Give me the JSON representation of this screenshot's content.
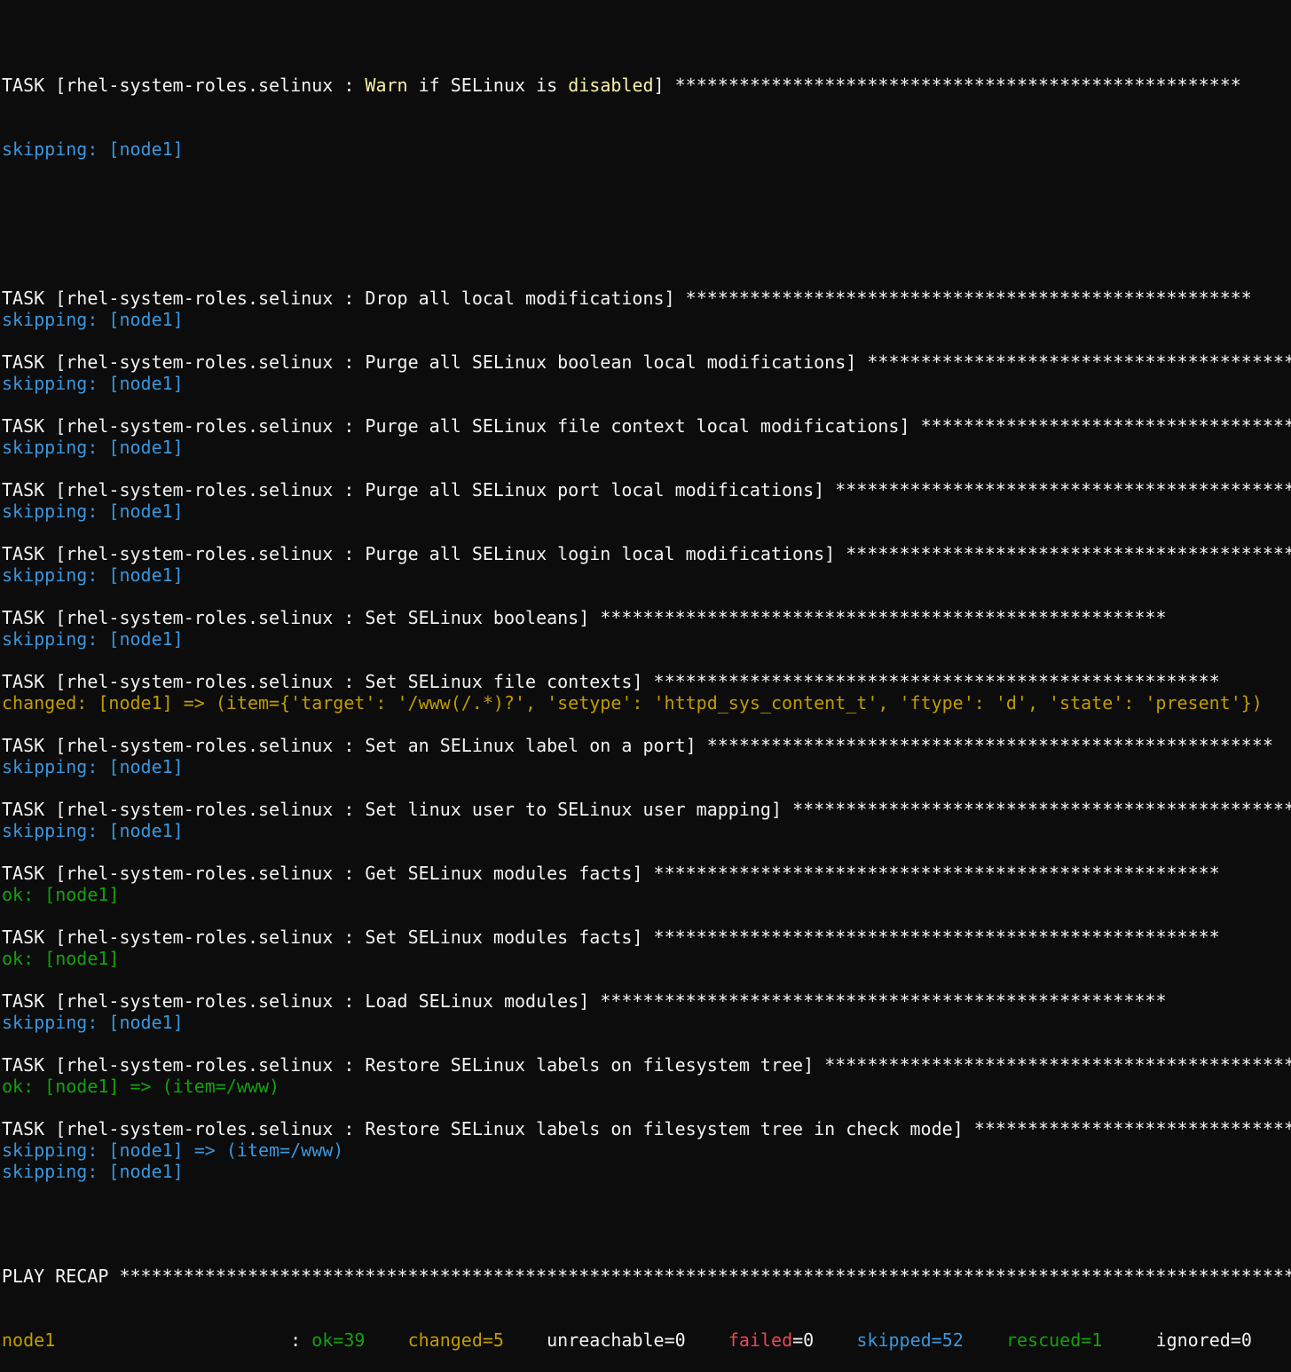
{
  "tasks": [
    {
      "title": "TASK [rhel-system-roles.selinux : ",
      "name_plain": "",
      "name_warn": "Warn",
      "name_mid": " if SELinux is ",
      "name_warn2": "disabled",
      "close": "] ",
      "stars": "*****************************************************",
      "results": [
        {
          "kind": "skip",
          "text": "skipping: [node1]"
        }
      ]
    },
    {
      "title": "TASK [rhel-system-roles.selinux : ",
      "name": "Drop all local modifications",
      "close": "] ",
      "stars": "*****************************************************",
      "results": [
        {
          "kind": "skip",
          "text": "skipping: [node1]"
        }
      ]
    },
    {
      "title": "TASK [rhel-system-roles.selinux : ",
      "name": "Purge all SELinux boolean local modifications",
      "close": "] ",
      "stars": "*****************************************************",
      "results": [
        {
          "kind": "skip",
          "text": "skipping: [node1]"
        }
      ]
    },
    {
      "title": "TASK [rhel-system-roles.selinux : ",
      "name": "Purge all SELinux file context local modifications",
      "close": "] ",
      "stars": "*****************************************************",
      "results": [
        {
          "kind": "skip",
          "text": "skipping: [node1]"
        }
      ]
    },
    {
      "title": "TASK [rhel-system-roles.selinux : ",
      "name": "Purge all SELinux port local modifications",
      "close": "] ",
      "stars": "*****************************************************",
      "results": [
        {
          "kind": "skip",
          "text": "skipping: [node1]"
        }
      ]
    },
    {
      "title": "TASK [rhel-system-roles.selinux : ",
      "name": "Purge all SELinux login local modifications",
      "close": "] ",
      "stars": "*****************************************************",
      "results": [
        {
          "kind": "skip",
          "text": "skipping: [node1]"
        }
      ]
    },
    {
      "title": "TASK [rhel-system-roles.selinux : ",
      "name": "Set SELinux booleans",
      "close": "] ",
      "stars": "*****************************************************",
      "results": [
        {
          "kind": "skip",
          "text": "skipping: [node1]"
        }
      ]
    },
    {
      "title": "TASK [rhel-system-roles.selinux : ",
      "name": "Set SELinux file contexts",
      "close": "] ",
      "stars": "*****************************************************",
      "results": [
        {
          "kind": "changed",
          "text": "changed: [node1] => (item={'target': '/www(/.*)?', 'setype': 'httpd_sys_content_t', 'ftype': 'd', 'state': 'present'})"
        }
      ]
    },
    {
      "title": "TASK [rhel-system-roles.selinux : ",
      "name": "Set an SELinux label on a port",
      "close": "] ",
      "stars": "*****************************************************",
      "results": [
        {
          "kind": "skip",
          "text": "skipping: [node1]"
        }
      ]
    },
    {
      "title": "TASK [rhel-system-roles.selinux : ",
      "name": "Set linux user to SELinux user mapping",
      "close": "] ",
      "stars": "*****************************************************",
      "results": [
        {
          "kind": "skip",
          "text": "skipping: [node1]"
        }
      ]
    },
    {
      "title": "TASK [rhel-system-roles.selinux : ",
      "name": "Get SELinux modules facts",
      "close": "] ",
      "stars": "*****************************************************",
      "results": [
        {
          "kind": "ok",
          "text": "ok: [node1]"
        }
      ]
    },
    {
      "title": "TASK [rhel-system-roles.selinux : ",
      "name": "Set SELinux modules facts",
      "close": "] ",
      "stars": "*****************************************************",
      "results": [
        {
          "kind": "ok",
          "text": "ok: [node1]"
        }
      ]
    },
    {
      "title": "TASK [rhel-system-roles.selinux : ",
      "name": "Load SELinux modules",
      "close": "] ",
      "stars": "*****************************************************",
      "results": [
        {
          "kind": "skip",
          "text": "skipping: [node1]"
        }
      ]
    },
    {
      "title": "TASK [rhel-system-roles.selinux : ",
      "name": "Restore SELinux labels on filesystem tree",
      "close": "] ",
      "stars": "*****************************************************",
      "results": [
        {
          "kind": "ok",
          "text": "ok: [node1] => (item=/www)"
        }
      ]
    },
    {
      "title": "TASK [rhel-system-roles.selinux : ",
      "name": "Restore SELinux labels on filesystem tree in check mode",
      "close": "] ",
      "stars": "*****************************************************",
      "results": [
        {
          "kind": "skip",
          "text": "skipping: [node1] => (item=/www)"
        },
        {
          "kind": "skip",
          "text": "skipping: [node1]"
        }
      ]
    }
  ],
  "recap": {
    "header": "PLAY RECAP ",
    "stars": "**********************************************************************************************************************************",
    "host": "node1",
    "sep": "                      : ",
    "ok": "ok=39",
    "changed": "changed=5",
    "unreachable": "unreachable=0",
    "failed_key": "failed",
    "failed_val": "=0",
    "skipped": "skipped=52",
    "rescued": "rescued=1",
    "ignored": "ignored=0"
  },
  "colors": {
    "background": "#0c0c0c",
    "foreground": "#f2f2f2",
    "skipping": "#3a96dd",
    "ok": "#13a10e",
    "changed": "#c19c00",
    "failed": "#e74856"
  }
}
